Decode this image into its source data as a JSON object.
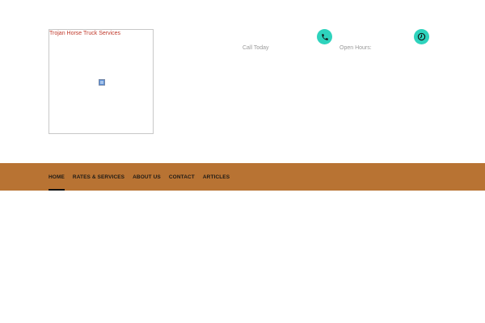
{
  "header": {
    "logo_alt": "Trojan Horse Truck Services",
    "call": {
      "icon": "phone-icon",
      "label": "Call Today"
    },
    "hours": {
      "icon": "clock-icon",
      "label": "Open Hours:"
    },
    "accent_color": "#2ed3bd"
  },
  "nav": {
    "background_color": "#b87333",
    "items": [
      {
        "label": "HOME",
        "active": true
      },
      {
        "label": "RATES & SERVICES",
        "active": false
      },
      {
        "label": "ABOUT US",
        "active": false
      },
      {
        "label": "CONTACT",
        "active": false
      },
      {
        "label": "ARTICLES",
        "active": false
      }
    ]
  }
}
